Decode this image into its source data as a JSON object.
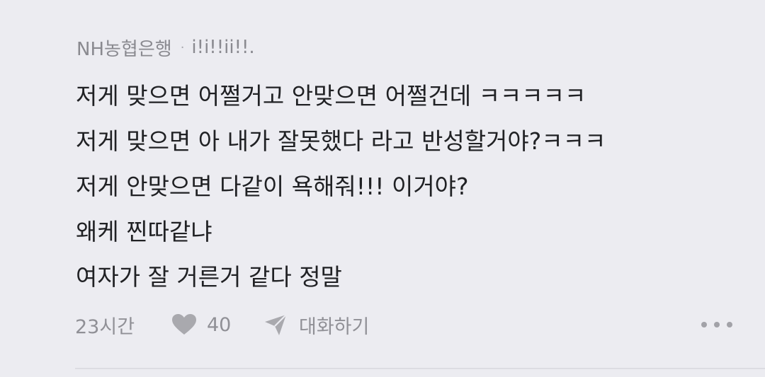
{
  "comment": {
    "author": "NH농협은행",
    "separator": "·",
    "nickname": "i!i!!ii!!.",
    "lines": [
      "저게 맞으면 어쩔거고 안맞으면 어쩔건데 ㅋㅋㅋㅋㅋ",
      "저게 맞으면 아 내가 잘못했다 라고 반성할거야?ㅋㅋㅋ",
      "저게 안맞으면 다같이 욕해줘!!! 이거야?",
      "왜케 찐따같냐",
      "여자가 잘 거른거 같다 정말"
    ],
    "time": "23시간",
    "like_icon": "heart-icon",
    "like_count": "40",
    "reply_icon": "paper-plane-icon",
    "reply_label": "대화하기",
    "more_icon": "more-dots-icon"
  },
  "colors": {
    "background": "#ececf1",
    "text": "#202124",
    "meta": "#909096"
  }
}
